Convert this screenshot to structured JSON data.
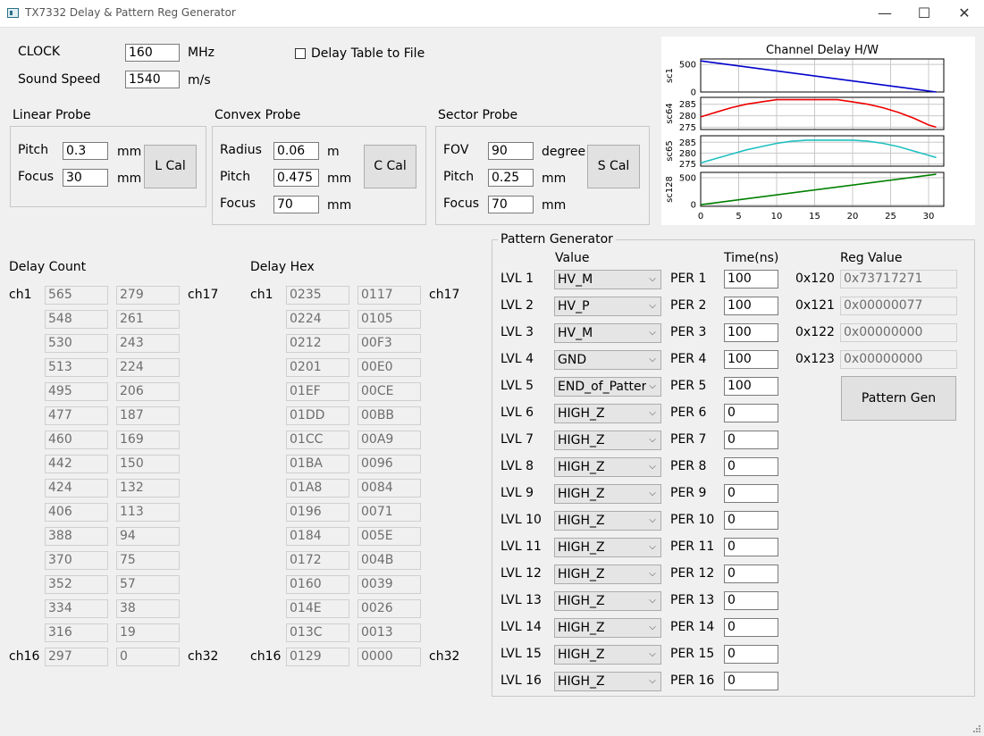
{
  "window": {
    "title": "TX7332 Delay & Pattern Reg Generator",
    "controls": [
      "—",
      "☐",
      "✕"
    ]
  },
  "settings": {
    "clock_label": "CLOCK",
    "clock_value": "160",
    "clock_unit": "MHz",
    "sound_label": "Sound Speed",
    "sound_value": "1540",
    "sound_unit": "m/s",
    "delay_to_file_label": "Delay Table to File",
    "delay_to_file_checked": false
  },
  "linear_probe": {
    "title": "Linear Probe",
    "pitch_label": "Pitch",
    "pitch_value": "0.3",
    "pitch_unit": "mm",
    "focus_label": "Focus",
    "focus_value": "30",
    "focus_unit": "mm",
    "button": "L Cal"
  },
  "convex_probe": {
    "title": "Convex Probe",
    "radius_label": "Radius",
    "radius_value": "0.06",
    "radius_unit": "m",
    "pitch_label": "Pitch",
    "pitch_value": "0.475",
    "pitch_unit": "mm",
    "focus_label": "Focus",
    "focus_value": "70",
    "focus_unit": "mm",
    "button": "C Cal"
  },
  "sector_probe": {
    "title": "Sector Probe",
    "fov_label": "FOV",
    "fov_value": "90",
    "fov_unit": "degree",
    "pitch_label": "Pitch",
    "pitch_value": "0.25",
    "pitch_unit": "mm",
    "focus_label": "Focus",
    "focus_value": "70",
    "focus_unit": "mm",
    "button": "S Cal"
  },
  "delay_count": {
    "title": "Delay Count",
    "ch_first_left": "ch1",
    "ch_first_right": "ch17",
    "ch_last_left": "ch16",
    "ch_last_right": "ch32",
    "col1": [
      "565",
      "548",
      "530",
      "513",
      "495",
      "477",
      "460",
      "442",
      "424",
      "406",
      "388",
      "370",
      "352",
      "334",
      "316",
      "297"
    ],
    "col2": [
      "279",
      "261",
      "243",
      "224",
      "206",
      "187",
      "169",
      "150",
      "132",
      "113",
      "94",
      "75",
      "57",
      "38",
      "19",
      "0"
    ]
  },
  "delay_hex": {
    "title": "Delay Hex",
    "ch_first_left": "ch1",
    "ch_first_right": "ch17",
    "ch_last_left": "ch16",
    "ch_last_right": "ch32",
    "col1": [
      "0235",
      "0224",
      "0212",
      "0201",
      "01EF",
      "01DD",
      "01CC",
      "01BA",
      "01A8",
      "0196",
      "0184",
      "0172",
      "0160",
      "014E",
      "013C",
      "0129"
    ],
    "col2": [
      "0117",
      "0105",
      "00F3",
      "00E0",
      "00CE",
      "00BB",
      "00A9",
      "0096",
      "0084",
      "0071",
      "005E",
      "004B",
      "0039",
      "0026",
      "0013",
      "0000"
    ]
  },
  "pattern": {
    "title": "Pattern Generator",
    "value_header": "Value",
    "time_header": "Time(ns)",
    "reg_header": "Reg Value",
    "rows": [
      {
        "lvl": "LVL 1",
        "value": "HV_M",
        "per": "PER 1",
        "time": "100"
      },
      {
        "lvl": "LVL 2",
        "value": "HV_P",
        "per": "PER 2",
        "time": "100"
      },
      {
        "lvl": "LVL 3",
        "value": "HV_M",
        "per": "PER 3",
        "time": "100"
      },
      {
        "lvl": "LVL 4",
        "value": "GND",
        "per": "PER 4",
        "time": "100"
      },
      {
        "lvl": "LVL 5",
        "value": "END_of_Pattern",
        "per": "PER 5",
        "time": "100"
      },
      {
        "lvl": "LVL 6",
        "value": "HIGH_Z",
        "per": "PER 6",
        "time": "0"
      },
      {
        "lvl": "LVL 7",
        "value": "HIGH_Z",
        "per": "PER 7",
        "time": "0"
      },
      {
        "lvl": "LVL 8",
        "value": "HIGH_Z",
        "per": "PER 8",
        "time": "0"
      },
      {
        "lvl": "LVL 9",
        "value": "HIGH_Z",
        "per": "PER 9",
        "time": "0"
      },
      {
        "lvl": "LVL 10",
        "value": "HIGH_Z",
        "per": "PER 10",
        "time": "0"
      },
      {
        "lvl": "LVL 11",
        "value": "HIGH_Z",
        "per": "PER 11",
        "time": "0"
      },
      {
        "lvl": "LVL 12",
        "value": "HIGH_Z",
        "per": "PER 12",
        "time": "0"
      },
      {
        "lvl": "LVL 13",
        "value": "HIGH_Z",
        "per": "PER 13",
        "time": "0"
      },
      {
        "lvl": "LVL 14",
        "value": "HIGH_Z",
        "per": "PER 14",
        "time": "0"
      },
      {
        "lvl": "LVL 15",
        "value": "HIGH_Z",
        "per": "PER 15",
        "time": "0"
      },
      {
        "lvl": "LVL 16",
        "value": "HIGH_Z",
        "per": "PER 16",
        "time": "0"
      }
    ],
    "regs": [
      {
        "addr": "0x120",
        "value": "0x73717271"
      },
      {
        "addr": "0x121",
        "value": "0x00000077"
      },
      {
        "addr": "0x122",
        "value": "0x00000000"
      },
      {
        "addr": "0x123",
        "value": "0x00000000"
      }
    ],
    "gen_button": "Pattern Gen"
  },
  "chart_data": {
    "type": "line",
    "title": "Channel Delay H/W",
    "x_ticks": [
      "0",
      "5",
      "10",
      "15",
      "20",
      "25",
      "30"
    ],
    "xlim": [
      0,
      32
    ],
    "grid": true,
    "subplots": [
      {
        "name": "sc1",
        "color": "#0000cc",
        "ylim": [
          0,
          600
        ],
        "yticks": [
          "0",
          "500"
        ],
        "x": [
          0,
          31
        ],
        "y": [
          565,
          0
        ]
      },
      {
        "name": "sc64",
        "color": "#ee0000",
        "ylim": [
          274,
          288
        ],
        "yticks": [
          "275",
          "280",
          "285"
        ],
        "x": [
          0,
          2,
          4,
          6,
          8,
          10,
          12,
          14,
          16,
          18,
          20,
          22,
          24,
          26,
          28,
          30,
          31
        ],
        "y": [
          279.5,
          281.5,
          283.5,
          285,
          286,
          287,
          287,
          287,
          287,
          287,
          286,
          285,
          283.5,
          281.5,
          279,
          276,
          275
        ]
      },
      {
        "name": "sc65",
        "color": "#20c0c0",
        "ylim": [
          274,
          288
        ],
        "yticks": [
          "275",
          "280",
          "285"
        ],
        "x": [
          0,
          2,
          4,
          6,
          8,
          10,
          12,
          14,
          16,
          18,
          20,
          22,
          24,
          26,
          28,
          30,
          31
        ],
        "y": [
          275.5,
          277.5,
          279.5,
          281.5,
          283,
          284.5,
          285.5,
          286,
          286,
          286,
          286,
          285.5,
          284.5,
          283,
          281,
          279,
          278
        ]
      },
      {
        "name": "sc128",
        "color": "#008000",
        "ylim": [
          -30,
          600
        ],
        "yticks": [
          "0",
          "500"
        ],
        "x": [
          0,
          31
        ],
        "y": [
          0,
          565
        ]
      }
    ]
  }
}
